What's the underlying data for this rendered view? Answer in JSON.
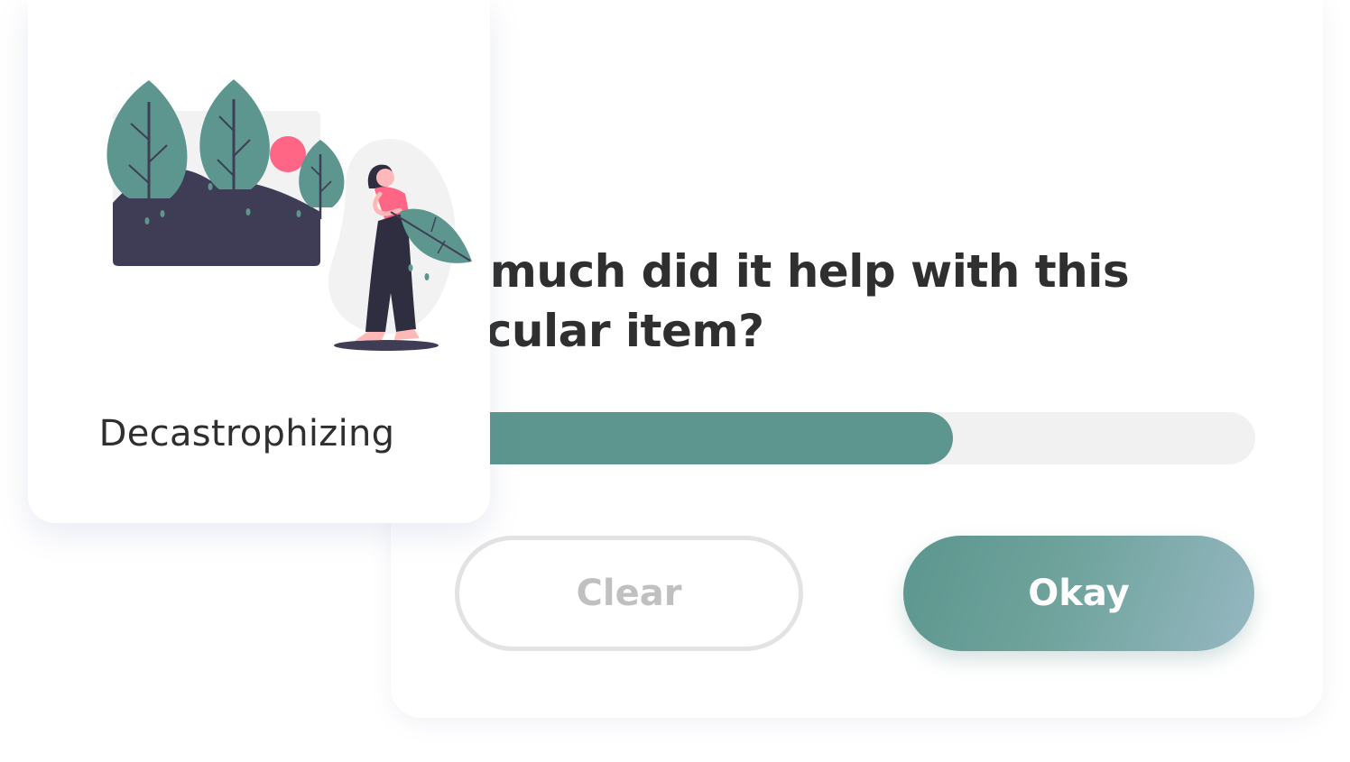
{
  "question": "How much did it help with this particular item?",
  "slider": {
    "value": 0.65
  },
  "buttons": {
    "clear_label": "Clear",
    "okay_label": "Okay"
  },
  "card": {
    "label": "Decastrophizing"
  },
  "colors": {
    "accent": "#5c968e",
    "track": "#f1f1f1",
    "text": "#2f2f2f",
    "highlight": "#ff6584",
    "dark": "#3f3d56"
  }
}
